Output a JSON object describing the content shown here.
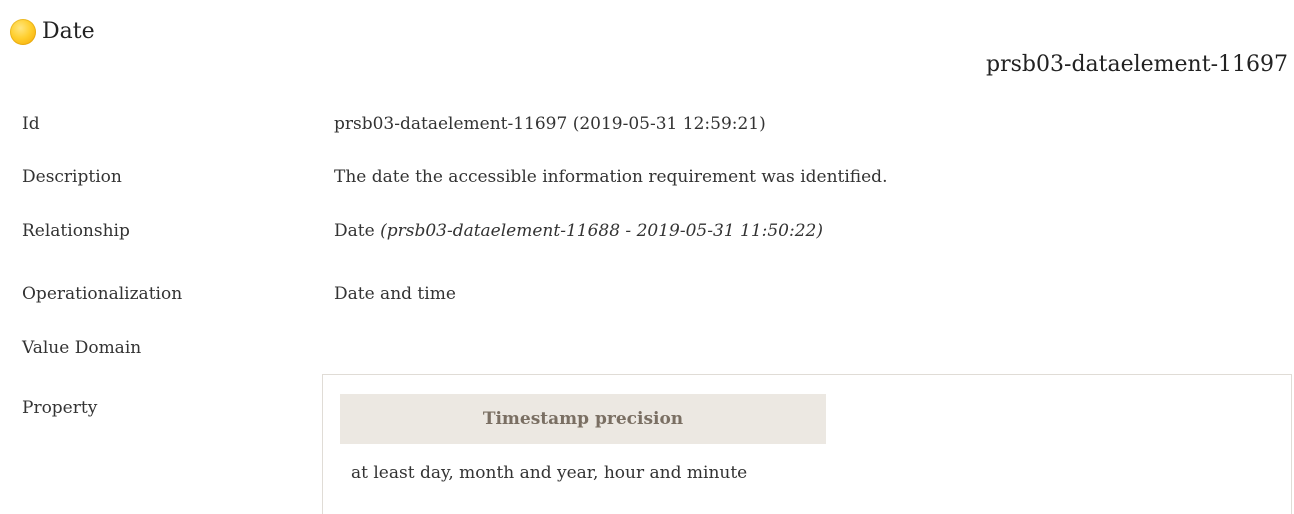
{
  "header": {
    "title": "Date",
    "status_color": "#ffcf2e",
    "element_id": "prsb03-dataelement-11697"
  },
  "rows": {
    "id": {
      "label": "Id",
      "value": "prsb03-dataelement-11697 (2019-05-31 12:59:21)"
    },
    "description": {
      "label": "Description",
      "value": "The date the accessible information requirement was identified."
    },
    "relationship": {
      "label": "Relationship",
      "value": "Date",
      "ref": "(prsb03-dataelement-11688 - 2019-05-31 11:50:22)"
    },
    "operationalization": {
      "label": "Operationalization",
      "value": "Date and time"
    },
    "value_domain": {
      "label": "Value Domain"
    },
    "property": {
      "label": "Property",
      "header": "Timestamp precision",
      "value": "at least day, month and year, hour and minute"
    }
  }
}
